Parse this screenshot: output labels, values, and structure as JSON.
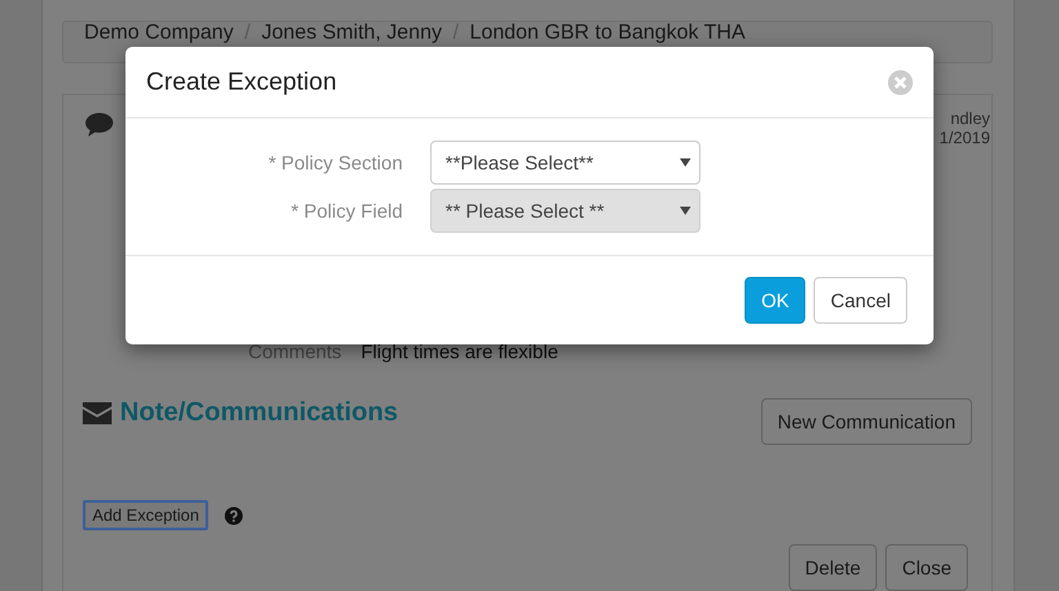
{
  "breadcrumb": {
    "separator": "/",
    "items": [
      "Demo Company",
      "Jones Smith, Jenny",
      "London GBR to Bangkok THA"
    ]
  },
  "card": {
    "meta": [
      "ndley",
      "1/2019"
    ],
    "comments": {
      "label": "Comments",
      "value": "Flight times are flexible"
    }
  },
  "notes": {
    "title": "Note/Communications",
    "button": "New Communication"
  },
  "add_exception": "Add Exception",
  "footer_buttons": [
    "Delete",
    "Close"
  ],
  "dialog": {
    "title": "Create Exception",
    "fields": [
      {
        "label": "* Policy Section",
        "value": "**Please Select**",
        "disabled": false
      },
      {
        "label": "* Policy Field",
        "value": "** Please Select **",
        "disabled": true
      }
    ],
    "buttons": [
      {
        "label": "OK",
        "kind": "primary"
      },
      {
        "label": "Cancel",
        "kind": "default"
      }
    ]
  }
}
